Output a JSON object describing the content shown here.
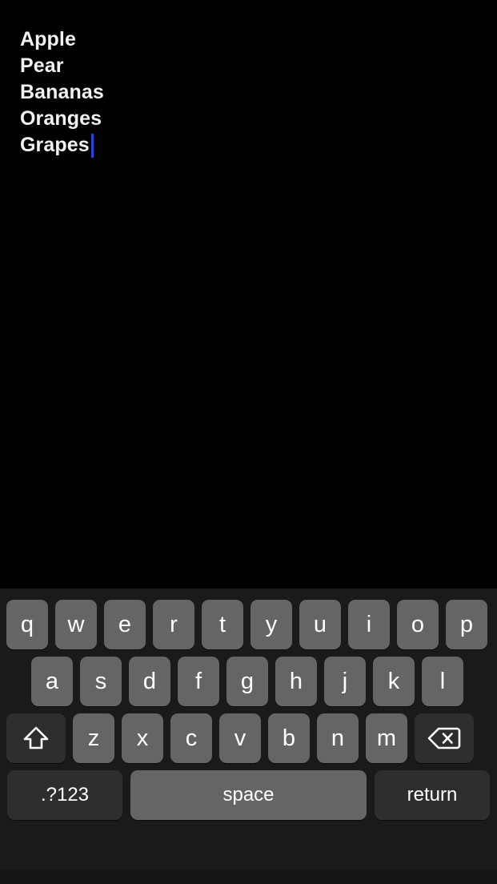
{
  "app": {
    "theme": "dark",
    "background_color": "#000000",
    "caret_color": "#2b44d8"
  },
  "editor": {
    "lines": [
      "Apple",
      "Pear",
      "Bananas",
      "Oranges",
      "Grapes"
    ],
    "caret_line_index": 4,
    "caret_visible": true
  },
  "keyboard": {
    "background_color": "#1a1a1a",
    "key_color": "#656565",
    "modifier_key_color": "#2e2e2e",
    "rows": [
      {
        "name": "row-1",
        "keys": [
          {
            "label": "q",
            "name": "key-q"
          },
          {
            "label": "w",
            "name": "key-w"
          },
          {
            "label": "e",
            "name": "key-e"
          },
          {
            "label": "r",
            "name": "key-r"
          },
          {
            "label": "t",
            "name": "key-t"
          },
          {
            "label": "y",
            "name": "key-y"
          },
          {
            "label": "u",
            "name": "key-u"
          },
          {
            "label": "i",
            "name": "key-i"
          },
          {
            "label": "o",
            "name": "key-o"
          },
          {
            "label": "p",
            "name": "key-p"
          }
        ]
      },
      {
        "name": "row-2",
        "keys": [
          {
            "label": "a",
            "name": "key-a"
          },
          {
            "label": "s",
            "name": "key-s"
          },
          {
            "label": "d",
            "name": "key-d"
          },
          {
            "label": "f",
            "name": "key-f"
          },
          {
            "label": "g",
            "name": "key-g"
          },
          {
            "label": "h",
            "name": "key-h"
          },
          {
            "label": "j",
            "name": "key-j"
          },
          {
            "label": "k",
            "name": "key-k"
          },
          {
            "label": "l",
            "name": "key-l"
          }
        ]
      },
      {
        "name": "row-3",
        "keys": [
          {
            "label": "",
            "name": "shift-key",
            "icon": "shift-arrow-icon"
          },
          {
            "label": "z",
            "name": "key-z"
          },
          {
            "label": "x",
            "name": "key-x"
          },
          {
            "label": "c",
            "name": "key-c"
          },
          {
            "label": "v",
            "name": "key-v"
          },
          {
            "label": "b",
            "name": "key-b"
          },
          {
            "label": "n",
            "name": "key-n"
          },
          {
            "label": "m",
            "name": "key-m"
          },
          {
            "label": "",
            "name": "backspace-key",
            "icon": "backspace-icon"
          }
        ]
      },
      {
        "name": "row-4",
        "keys": [
          {
            "label": ".?123",
            "name": "numeric-key"
          },
          {
            "label": "space",
            "name": "space-key"
          },
          {
            "label": "return",
            "name": "return-key"
          }
        ]
      }
    ],
    "numeric_label": ".?123",
    "space_label": "space",
    "return_label": "return"
  }
}
